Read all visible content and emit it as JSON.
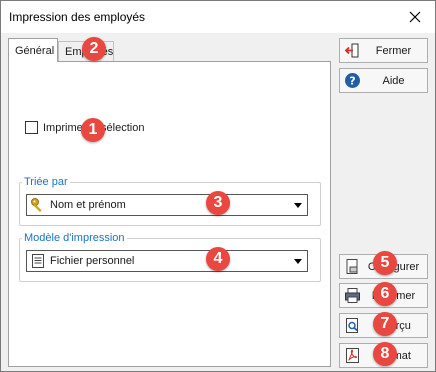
{
  "window": {
    "title": "Impression des employés"
  },
  "tabs": [
    {
      "label": "Général",
      "active": true
    },
    {
      "label": "Employés",
      "active": false
    }
  ],
  "options": {
    "print_selection_label": "Imprimer la sélection",
    "print_selection_checked": false
  },
  "sort_group": {
    "legend": "Triée par",
    "selected": "Nom et prénom",
    "icon": "key-icon"
  },
  "template_group": {
    "legend": "Modèle d'impression",
    "selected": "Fichier personnel",
    "icon": "document-icon"
  },
  "buttons": {
    "close": "Fermer",
    "help": "Aide",
    "configure": "Configurer",
    "print": "Imprimer",
    "preview": "Aperçu",
    "pdf": "Format"
  },
  "markers": [
    "1",
    "2",
    "3",
    "4",
    "5",
    "6",
    "7",
    "8"
  ],
  "colors": {
    "marker": "#e8483f",
    "legend": "#1a73c4"
  }
}
